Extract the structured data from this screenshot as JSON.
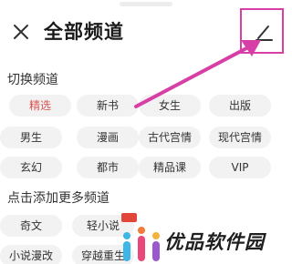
{
  "header": {
    "title": "全部频道",
    "close_icon": "close-icon",
    "edit_icon": "pencil-edit-icon"
  },
  "switch_section": {
    "title": "切换频道",
    "channels": [
      {
        "label": "精选",
        "selected": true
      },
      {
        "label": "新书",
        "selected": false
      },
      {
        "label": "女生",
        "selected": false
      },
      {
        "label": "出版",
        "selected": false
      },
      {
        "label": "男生",
        "selected": false
      },
      {
        "label": "漫画",
        "selected": false
      },
      {
        "label": "古代宫情",
        "selected": false
      },
      {
        "label": "现代宫情",
        "selected": false
      },
      {
        "label": "玄幻",
        "selected": false
      },
      {
        "label": "都市",
        "selected": false
      },
      {
        "label": "精品课",
        "selected": false
      },
      {
        "label": "VIP",
        "selected": false
      }
    ]
  },
  "add_section": {
    "title": "点击添加更多频道",
    "channels": [
      {
        "label": "奇文"
      },
      {
        "label": "轻小说"
      },
      {
        "label": "小说漫改"
      },
      {
        "label": "穿越重生"
      }
    ]
  },
  "annotation": {
    "color": "#d73fa7"
  },
  "watermark": {
    "text": "优品软件园",
    "logo_icon": "site-logo-icon"
  },
  "colors": {
    "selected_text": "#d9534f",
    "chip_bg": "#f2f2f2"
  }
}
